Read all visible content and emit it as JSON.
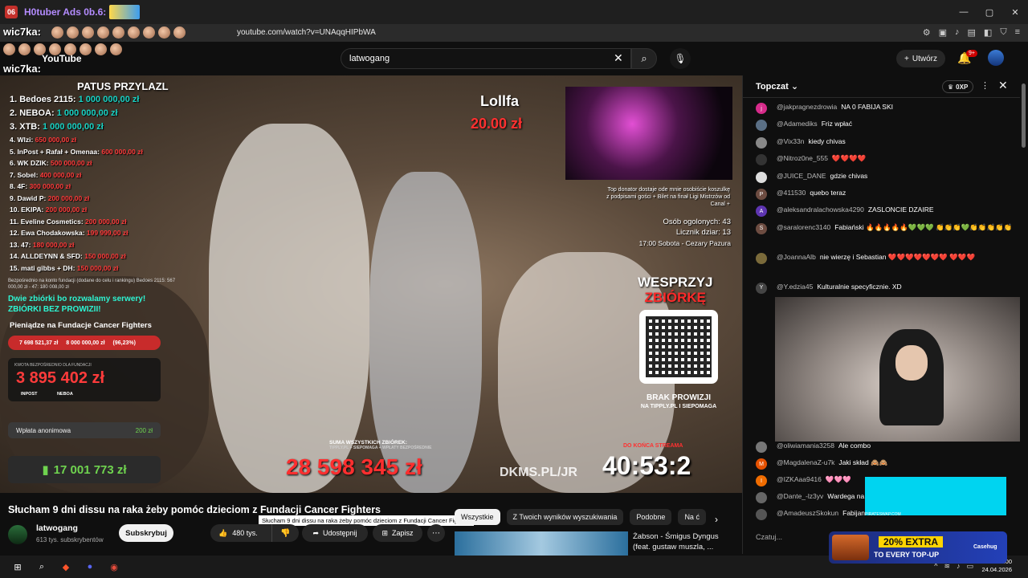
{
  "browser": {
    "tab_icon_text": "06",
    "tab_title": "H0tuber  Ads 0b.6:",
    "url": "youtube.com/watch?v=UNAqqHIPbWA",
    "window_controls": [
      "—",
      "▢",
      "✕"
    ]
  },
  "overlay_names": {
    "top": "wic7ka:",
    "second": "wic7ka:"
  },
  "youtube": {
    "logo_text": "YouTube",
    "search_value": "latwogang",
    "create_label": "Utwórz",
    "notif_count": "9+"
  },
  "video": {
    "top_title": "PATUS PRZYLAZL",
    "ranking": [
      {
        "label": "1. Bedoes 2115:",
        "value": "1 000 000,00 zł",
        "big": true
      },
      {
        "label": "2. NEBOA:",
        "value": "1 000 000,00 zł",
        "big": true
      },
      {
        "label": "3. XTB:",
        "value": "1 000 000,00 zł",
        "big": true
      },
      {
        "label": "4. Wlzi:",
        "value": "650 000,00 zł",
        "big": false
      },
      {
        "label": "5. InPost + Rafał + Omenaa:",
        "value": "600 000,00 zł",
        "big": false
      },
      {
        "label": "6. WK DZIK:",
        "value": "500 000,00 zł",
        "big": false
      },
      {
        "label": "7. Sobel:",
        "value": "400 000,00 zł",
        "big": false
      },
      {
        "label": "8. 4F:",
        "value": "300 000,00 zł",
        "big": false
      },
      {
        "label": "9. Dawid P:",
        "value": "200 000,00 zł",
        "big": false
      },
      {
        "label": "10. EKIPA:",
        "value": "200 000,00 zł",
        "big": false
      },
      {
        "label": "11. Eveline Cosmetics:",
        "value": "200 000,00 zł",
        "big": false
      },
      {
        "label": "12. Ewa Chodakowska:",
        "value": "199 999,00 zł",
        "big": false
      },
      {
        "label": "13. 47:",
        "value": "180 000,00 zł",
        "big": false
      },
      {
        "label": "14. ALLDEYNN & SFD:",
        "value": "150 000,00 zł",
        "big": false
      },
      {
        "label": "15. mati gibbs + DH:",
        "value": "150 000,00 zł",
        "big": false
      }
    ],
    "fund_note": "Bezpośrednio na konto fundacji (dodane do celu i rankingu) Bedoes 2115: 567 000,00 zł - 47: 180 008,00 zł",
    "fund_slogan_1": "Dwie zbiórki bo rozwalamy serwery!",
    "fund_slogan_2": "ZBIÓRKI BEZ PROWIZII!",
    "fund_header": "Pieniądze na Fundacje Cancer Fighters",
    "fund_progress_current": "7 698 521,37 zł",
    "fund_progress_goal": "8 000 000,00 zł",
    "fund_progress_pct": "(96,23%)",
    "panel_label": "KWOTA BEZPOŚREDNIO DLA FUNDACJI",
    "panel_amount": "3 895 402 zł",
    "panel_inpost": "INPOST",
    "panel_neboa": "NEBOA",
    "donate_label": "Wpłata anonimowa",
    "donate_amount": "200 zł",
    "total_amount": "17 001 773 zł",
    "lollfa_name": "Lollfa",
    "lollfa_amount": "20.00 zł",
    "top_donor": "Top donator dostaje ode mnie osobiście koszulkę z podpisami gości + Bilet na finał Ligi Mistrzów od Canal +",
    "stats_line1": "Osób ogolonych: 43",
    "stats_line2": "Licznik dziar: 13",
    "schedule": "17:00 Sobota - Cezary Pazura",
    "wesprzyj_1": "WESPRZYJ",
    "wesprzyj_2": "ZBIÓRKĘ",
    "brak_1": "BRAK PROWIZJI",
    "brak_2": "NA TIPPLY.PL I SIEPOMAGA",
    "suma_label": "SUMA WSZYSTKICH ZBIÓREK:",
    "suma_sub": "TIPPLY.PL + SIEPOMAGA + WPŁATY BEZPOŚREDNIE",
    "suma_amount": "28 598 345 zł",
    "dkms": "DKMS.PL/JR",
    "timer_label": "DO KOŃCA STREAMA",
    "timer": "40:53:2"
  },
  "info": {
    "title": "Słucham 9 dni dissu na raka żeby pomóc dzieciom z Fundacji Cancer Fighters",
    "tooltip": "Słucham 9 dni dissu na raka żeby pomóc dzieciom z Fundacji Cancer Fighters",
    "channel": "latwogang",
    "subs": "613 tys. subskrybentów",
    "subscribe": "Subskrybuj",
    "likes": "480 tys.",
    "share": "Udostępnij",
    "save": "Zapisz"
  },
  "chips": [
    "Wszystkie",
    "Z Twoich wyników wyszukiwania",
    "Podobne",
    "Na ć"
  ],
  "recommendation": {
    "title": "Żabson - Śmigus Dyngus (feat. gustaw muszla, ..."
  },
  "chat": {
    "title": "Topczat",
    "xp": "0XP",
    "input_placeholder": "Czatuj...",
    "messages": [
      {
        "author": "@jakpragnezdrowia",
        "text": "NA 0 FABIJA SKI",
        "color": "#d62b8a",
        "initial": "j"
      },
      {
        "author": "@Adamediks",
        "text": "Friz wpłać",
        "color": "#5a6f85",
        "initial": ""
      },
      {
        "author": "@Vix33n",
        "text": "kiedy chivas",
        "color": "#888",
        "initial": ""
      },
      {
        "author": "@Nitroz0ne_555",
        "text": "❤️❤️❤️❤️",
        "color": "#333",
        "initial": ""
      },
      {
        "author": "@JUICE_DANE",
        "text": "gdzie chivas",
        "color": "#ddd",
        "initial": ""
      },
      {
        "author": "@411530",
        "text": "quebo teraz",
        "color": "#6d4c41",
        "initial": "P"
      },
      {
        "author": "@aleksandralachowska4290",
        "text": "ZASLONCIE DZAIRE",
        "color": "#5e35b1",
        "initial": "A"
      },
      {
        "author": "@saralorenc3140",
        "text": "Fabiański 🔥🔥🔥🔥🔥💚💚💚 👏👏👏💚👏👏👏👏👏",
        "color": "#6d4c41",
        "initial": "S"
      },
      {
        "author": "@JoannaAlb",
        "text": "nie wierzę i Sebastian ❤️❤️❤️❤️❤️❤️❤️ ❤️❤️❤️",
        "color": "#7a6a3a",
        "initial": ""
      },
      {
        "author": "@Y.edzia45",
        "text": "Kulturalnie specyficznie. XD",
        "color": "#444",
        "initial": "Y"
      }
    ],
    "bottom_messages": [
      {
        "author": "@oliwiamania3258",
        "text": "Ale combo",
        "color": "#777",
        "initial": ""
      },
      {
        "author": "@MagdalenaZ-u7k",
        "text": "Jaki skład 🙈🙈",
        "color": "#e65100",
        "initial": "M"
      },
      {
        "author": "@IZKAaa9416",
        "text": "🩷🩷🩷",
        "color": "#ef6c00",
        "initial": "I"
      },
      {
        "author": "@Dante_-lz3yv",
        "text": "Wardega na",
        "color": "#666",
        "initial": ""
      },
      {
        "author": "@AmadeuszSkokun",
        "text": "Fabijan",
        "color": "#555",
        "initial": ""
      }
    ],
    "cyan_caption": "PIRATESWAP.COM"
  },
  "promo": {
    "title": "20% EXTRA",
    "subtitle": "TO EVERY TOP-UP",
    "brand": "Casehug"
  },
  "taskbar": {
    "time": "23:00",
    "date": "24.04.2026"
  }
}
